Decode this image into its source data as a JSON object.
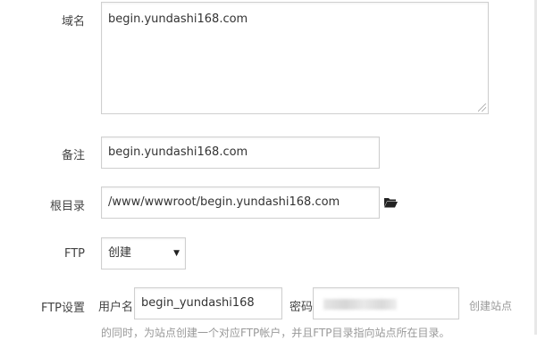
{
  "form": {
    "domain": {
      "label": "域名",
      "value": "begin.yundashi168.com"
    },
    "remark": {
      "label": "备注",
      "value": "begin.yundashi168.com"
    },
    "root_dir": {
      "label": "根目录",
      "value": "/www/wwwroot/begin.yundashi168.com",
      "browse_icon": "folder-open-icon"
    },
    "ftp": {
      "label": "FTP",
      "selected": "创建"
    },
    "ftp_settings": {
      "label": "FTP设置",
      "username_label": "用户名",
      "username_value": "begin_yundashi168",
      "password_label": "密码",
      "hint_right": "创建站点",
      "hint_bottom": "的同时，为站点创建一个对应FTP帐户，并且FTP目录指向站点所在目录。"
    }
  }
}
